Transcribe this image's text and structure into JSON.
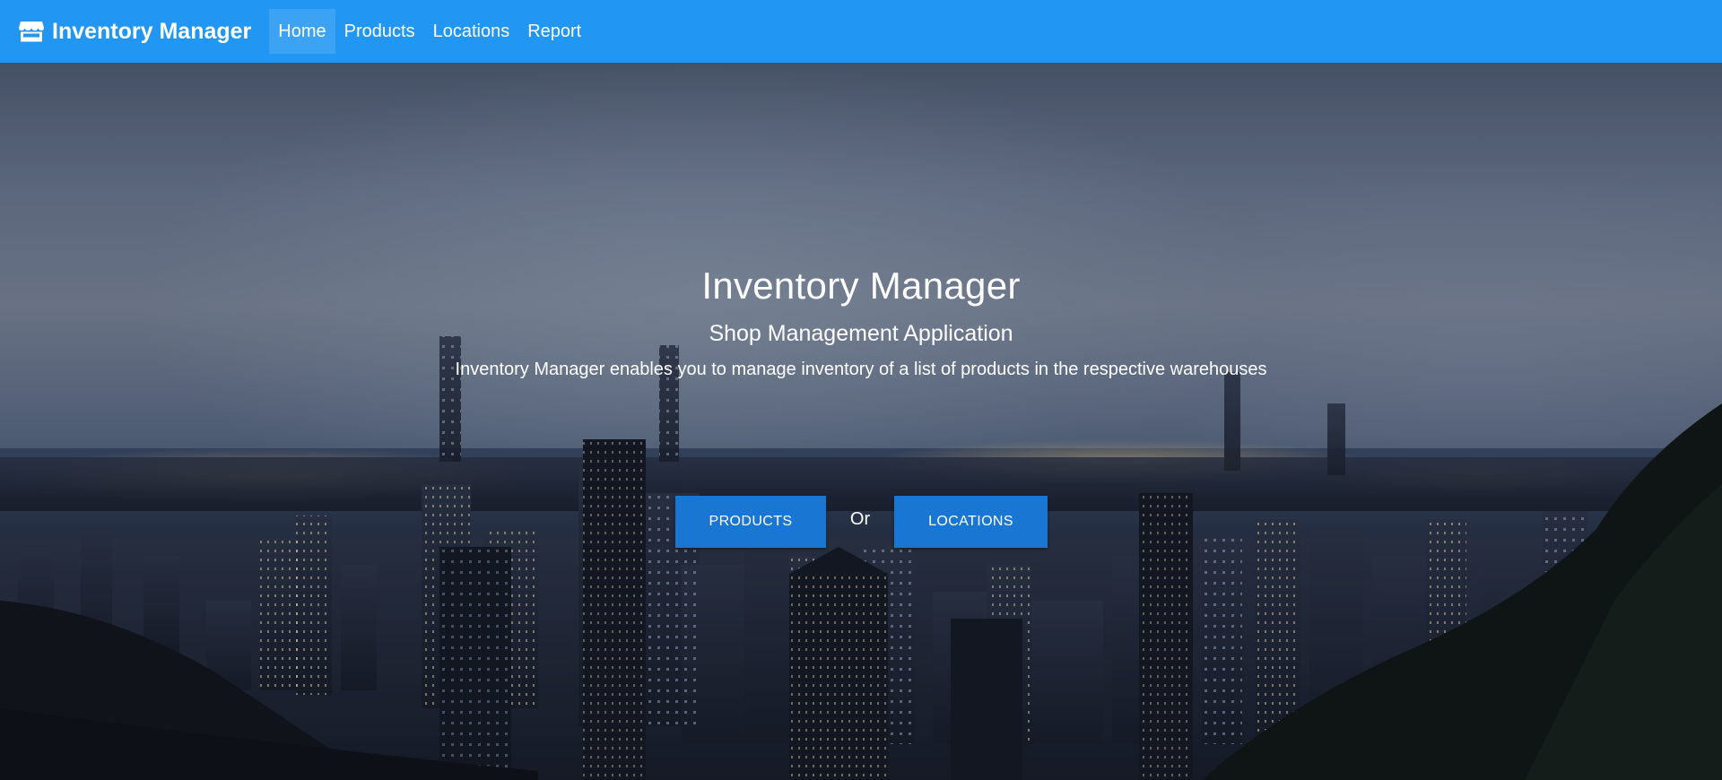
{
  "navbar": {
    "brand": "Inventory Manager",
    "brand_icon": "store-icon",
    "items": [
      {
        "label": "Home",
        "active": true
      },
      {
        "label": "Products",
        "active": false
      },
      {
        "label": "Locations",
        "active": false
      },
      {
        "label": "Report",
        "active": false
      }
    ],
    "color": "#2196f3"
  },
  "hero": {
    "title": "Inventory Manager",
    "subtitle": "Shop Management Application",
    "description": "Inventory Manager enables you to manage inventory of a list of products in the respective warehouses",
    "buttons": {
      "products": "PRODUCTS",
      "or": "Or",
      "locations": "LOCATIONS"
    },
    "button_color": "#1976d2",
    "background": "night city skyline"
  }
}
